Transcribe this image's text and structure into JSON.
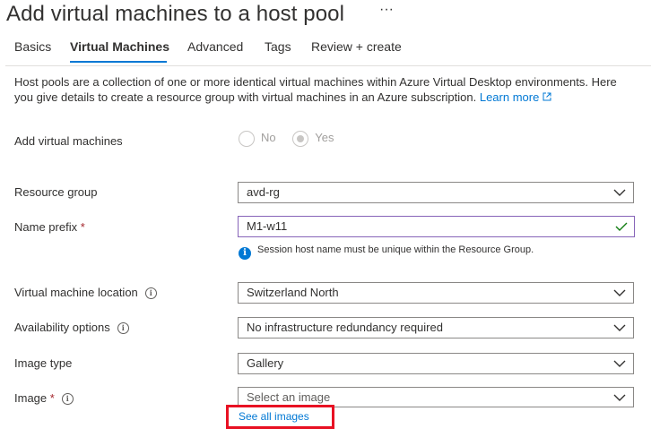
{
  "header": {
    "title": "Add virtual machines to a host pool",
    "more_label": "···"
  },
  "tabs": [
    {
      "label": "Basics"
    },
    {
      "label": "Virtual Machines",
      "active": true
    },
    {
      "label": "Advanced"
    },
    {
      "label": "Tags"
    },
    {
      "label": "Review + create"
    }
  ],
  "description": {
    "text": "Host pools are a collection of one or more identical virtual machines within Azure Virtual Desktop environments. Here you give details to create a resource group with virtual machines in an Azure subscription.",
    "link_label": "Learn more",
    "link_icon": "external-link-icon"
  },
  "form": {
    "add_vms": {
      "label": "Add virtual machines",
      "options": [
        "No",
        "Yes"
      ],
      "selected": "Yes",
      "disabled": true
    },
    "resource_group": {
      "label": "Resource group",
      "value": "avd-rg"
    },
    "name_prefix": {
      "label": "Name prefix",
      "required_mark": "*",
      "value": "M1-w11",
      "valid": true,
      "note": "Session host name must be unique within the Resource Group."
    },
    "vm_location": {
      "label": "Virtual machine location",
      "value": "Switzerland North"
    },
    "availability": {
      "label": "Availability options",
      "value": "No infrastructure redundancy required"
    },
    "image_type": {
      "label": "Image type",
      "value": "Gallery"
    },
    "image": {
      "label": "Image",
      "required_mark": "*",
      "placeholder": "Select an image",
      "see_all_label": "See all images"
    }
  },
  "colors": {
    "accent": "#0078d4",
    "required": "#a4262c",
    "valid_check": "#107c10",
    "highlight_box": "#e81123",
    "focus_border": "#8764b8"
  }
}
